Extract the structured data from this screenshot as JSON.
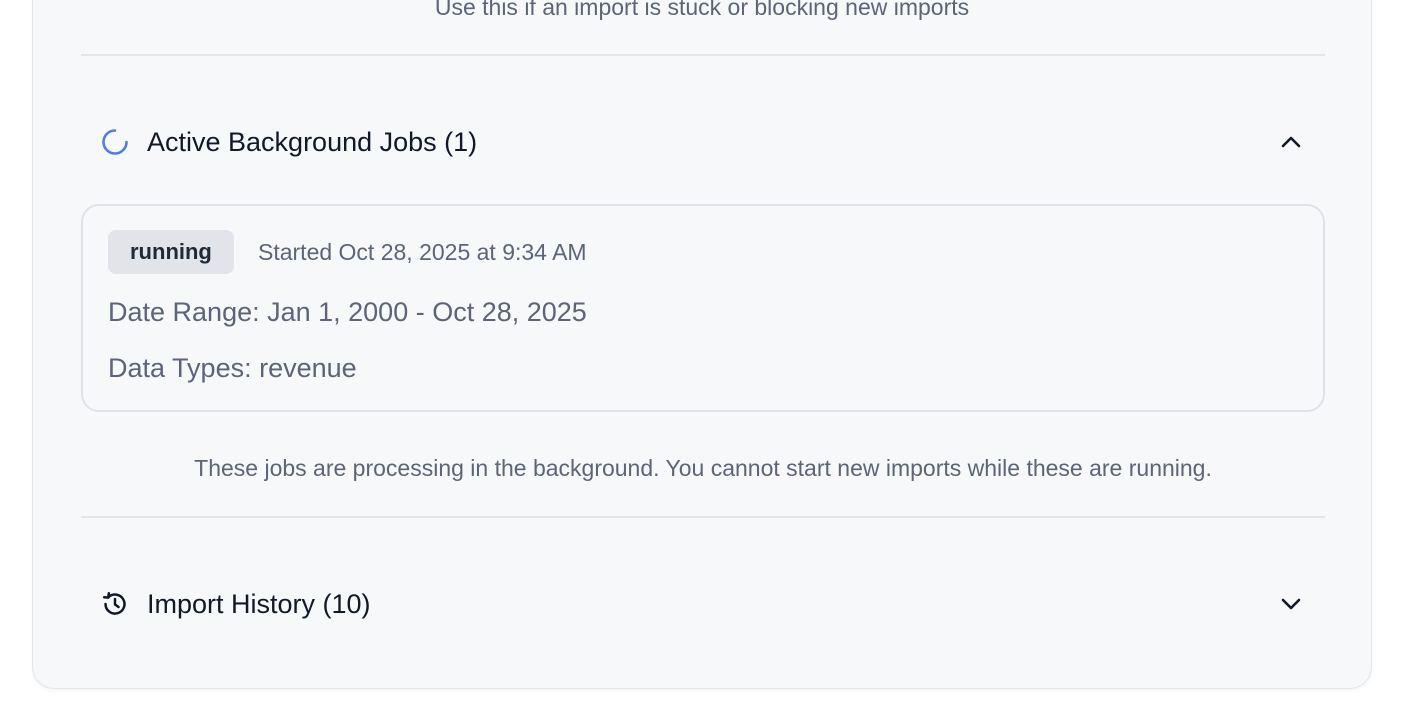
{
  "top_hint": "Use this if an import is stuck or blocking new imports",
  "active_jobs": {
    "title": "Active Background Jobs (1)",
    "icon": "spinner-icon",
    "toggle_icon": "chevron-up-icon",
    "expanded": true,
    "jobs": [
      {
        "status": "running",
        "started": "Started Oct 28, 2025 at 9:34 AM",
        "date_range": "Date Range: Jan 1, 2000 - Oct 28, 2025",
        "data_types": "Data Types: revenue"
      }
    ],
    "note": "These jobs are processing in the background. You cannot start new imports while these are running."
  },
  "import_history": {
    "title": "Import History (10)",
    "icon": "history-icon",
    "toggle_icon": "chevron-down-icon",
    "expanded": false
  },
  "colors": {
    "spinner_accent": "#4f7be8",
    "card_background": "#f7f8fa",
    "muted_text": "#5b6577",
    "badge_background": "#e2e4e9"
  }
}
